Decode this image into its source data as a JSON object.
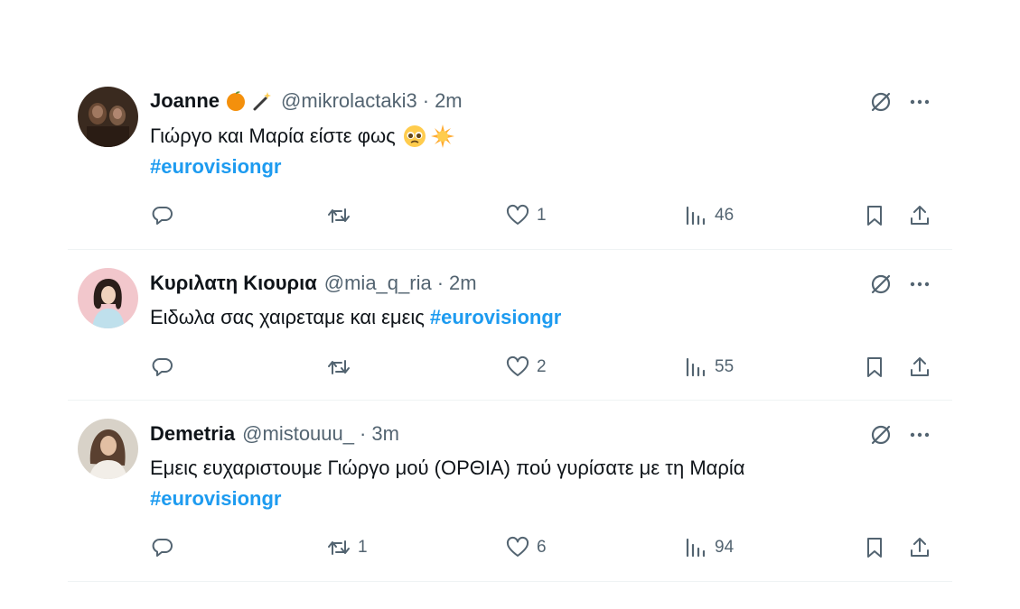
{
  "tweets": [
    {
      "name": "Joanne",
      "name_emojis": [
        "orange-emoji",
        "magic-wand-emoji"
      ],
      "handle": "@mikrolactaki3",
      "separator": "·",
      "time": "2m",
      "text": "Γιώργο και Μαρία είστε φως",
      "text_emojis": [
        "pleading-face-emoji",
        "sun-emoji"
      ],
      "hashtag": "#eurovisiongr",
      "stats": {
        "replies": "",
        "retweets": "",
        "likes": "1",
        "views": "46"
      }
    },
    {
      "name": "Κυριλατη Κιουρια",
      "name_emojis": [],
      "handle": "@mia_q_ria",
      "separator": "·",
      "time": "2m",
      "text": "Ειδωλα σας χαιρεταμε και εμεις",
      "hashtag": "#eurovisiongr",
      "stats": {
        "replies": "",
        "retweets": "",
        "likes": "2",
        "views": "55"
      }
    },
    {
      "name": "Demetria",
      "name_emojis": [],
      "handle": "@mistouuu_",
      "separator": "·",
      "time": "3m",
      "text": "Εμεις ευχαριστουμε Γιώργο μού (ΟΡΘΙΑ) πού γυρίσατε με τη Μαρία",
      "hashtag": "#eurovisiongr",
      "stats": {
        "replies": "",
        "retweets": "1",
        "likes": "6",
        "views": "94"
      }
    }
  ],
  "colors": {
    "text": "#0f1419",
    "secondary": "#536471",
    "hashtag": "#1d9bf0",
    "divider": "#eff3f4"
  },
  "icons": [
    "reply-icon",
    "retweet-icon",
    "like-icon",
    "views-icon",
    "bookmark-icon",
    "share-icon",
    "grok-icon",
    "more-icon"
  ]
}
